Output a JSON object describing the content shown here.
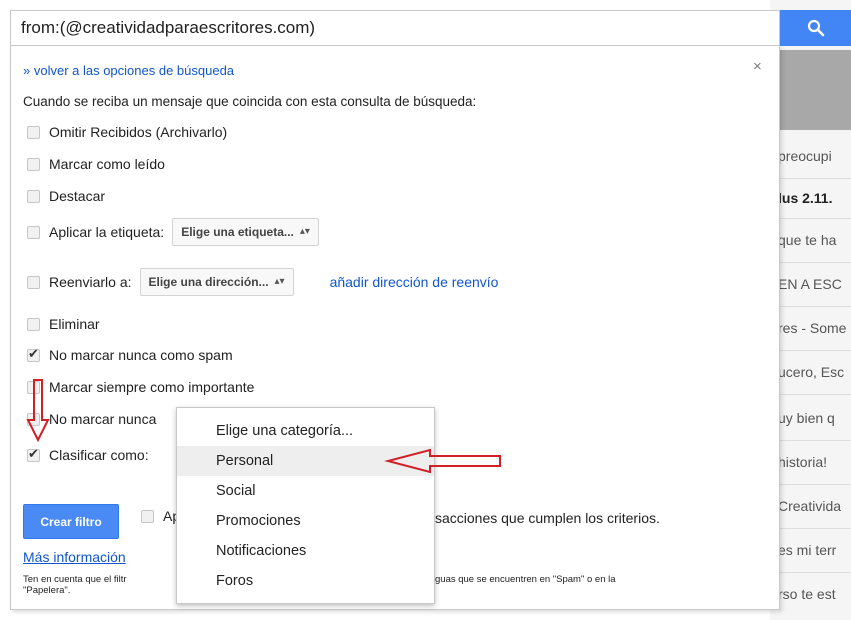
{
  "search": {
    "query": "from:(@creatividadparaescritores.com)",
    "button_icon": "search-icon"
  },
  "background_list": [
    {
      "text": "preocupi",
      "bold": false
    },
    {
      "text": "lus 2.11.",
      "bold": true
    },
    {
      "text": "que te ha",
      "bold": false
    },
    {
      "text": "EN A ESC",
      "bold": false
    },
    {
      "text": "res - Some",
      "bold": false
    },
    {
      "text": "ucero, Esc",
      "bold": false
    },
    {
      "text": "uy bien q",
      "bold": false
    },
    {
      "text": "historia!",
      "bold": false
    },
    {
      "text": "Creativida",
      "bold": false
    },
    {
      "text": "es mi terr",
      "bold": false
    },
    {
      "text": "rso te est",
      "bold": false
    }
  ],
  "panel": {
    "back_link": "» volver a las opciones de búsqueda",
    "close": "×",
    "intro": "Cuando se reciba un mensaje que coincida con esta consulta de búsqueda:",
    "options": {
      "skip_inbox": {
        "label": "Omitir Recibidos (Archivarlo)",
        "checked": false
      },
      "mark_read": {
        "label": "Marcar como leído",
        "checked": false
      },
      "star": {
        "label": "Destacar",
        "checked": false
      },
      "apply_label": {
        "label": "Aplicar la etiqueta:",
        "checked": false,
        "select_value": "Elige una etiqueta..."
      },
      "forward": {
        "label": "Reenviarlo a:",
        "checked": false,
        "select_value": "Elige una dirección...",
        "link": "añadir dirección de reenvío"
      },
      "delete": {
        "label": "Eliminar",
        "checked": false
      },
      "never_spam": {
        "label": "No marcar nunca como spam",
        "checked": true
      },
      "always_important": {
        "label": "Marcar siempre como importante",
        "checked": false
      },
      "never_important": {
        "label": "No marcar nunca",
        "checked": false
      },
      "categorize": {
        "label": "Clasificar como:",
        "checked": true
      }
    },
    "create_button": "Crear filtro",
    "apply_prefix": "Ap",
    "apply_suffix": "sacciones que cumplen los criterios.",
    "more_info": "Más información",
    "note_line1": "Ten en cuenta que el filtr",
    "note_line2": "\"Papelera\".",
    "note_right": "guas que se encuentren en \"Spam\" o en la"
  },
  "category_dropdown": {
    "items": [
      "Elige una categoría...",
      "Personal",
      "Social",
      "Promociones",
      "Notificaciones",
      "Foros"
    ],
    "highlighted": "Personal"
  },
  "annotation_color": "#d01f26"
}
